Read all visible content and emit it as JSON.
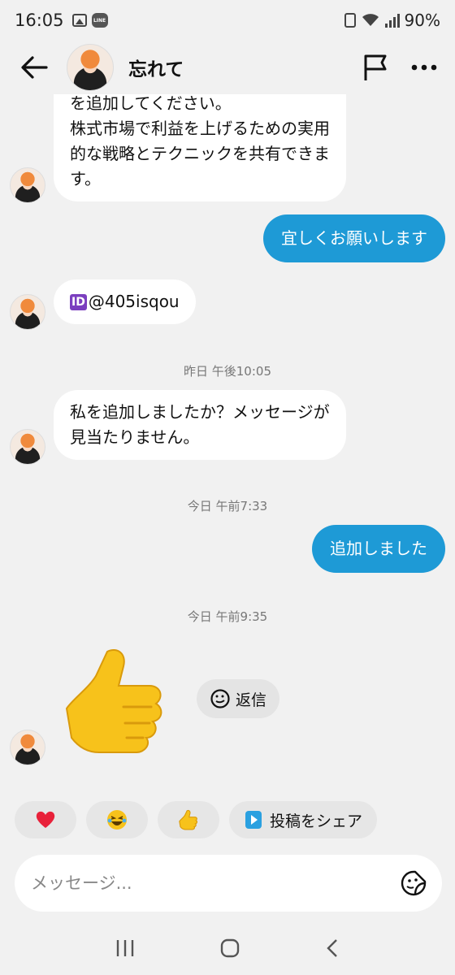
{
  "status_bar": {
    "time": "16:05",
    "line_badge": "LINE",
    "battery": "90%"
  },
  "header": {
    "title": "忘れて"
  },
  "messages": [
    {
      "dir": "in",
      "lines": [
        "を追加してください。",
        "株式市場で利益を上げるための実用",
        "的な戦略とテクニックを共有できま",
        "す。"
      ]
    },
    {
      "dir": "out",
      "text": "宜しくお願いします"
    },
    {
      "dir": "in",
      "id_badge": "ID",
      "text": "@405isqou"
    },
    {
      "timestamp": "昨日 午後10:05"
    },
    {
      "dir": "in",
      "lines": [
        "私を追加しましたか？メッセージが",
        "見当たりません。"
      ]
    },
    {
      "timestamp": "今日 午前7:33"
    },
    {
      "dir": "out",
      "text": "追加しました"
    },
    {
      "timestamp": "今日 午前9:35"
    },
    {
      "dir": "in",
      "emoji": "thumbs-up"
    }
  ],
  "reply_chip": {
    "label": "返信"
  },
  "quick_replies": [
    {
      "emoji": "❤️"
    },
    {
      "emoji": "😂"
    },
    {
      "emoji": "👍"
    },
    {
      "label": "投稿をシェア"
    }
  ],
  "composer": {
    "placeholder": "メッセージ..."
  },
  "colors": {
    "outgoing": "#1e9ad6",
    "incoming": "#ffffff",
    "background": "#f1f1f1"
  }
}
